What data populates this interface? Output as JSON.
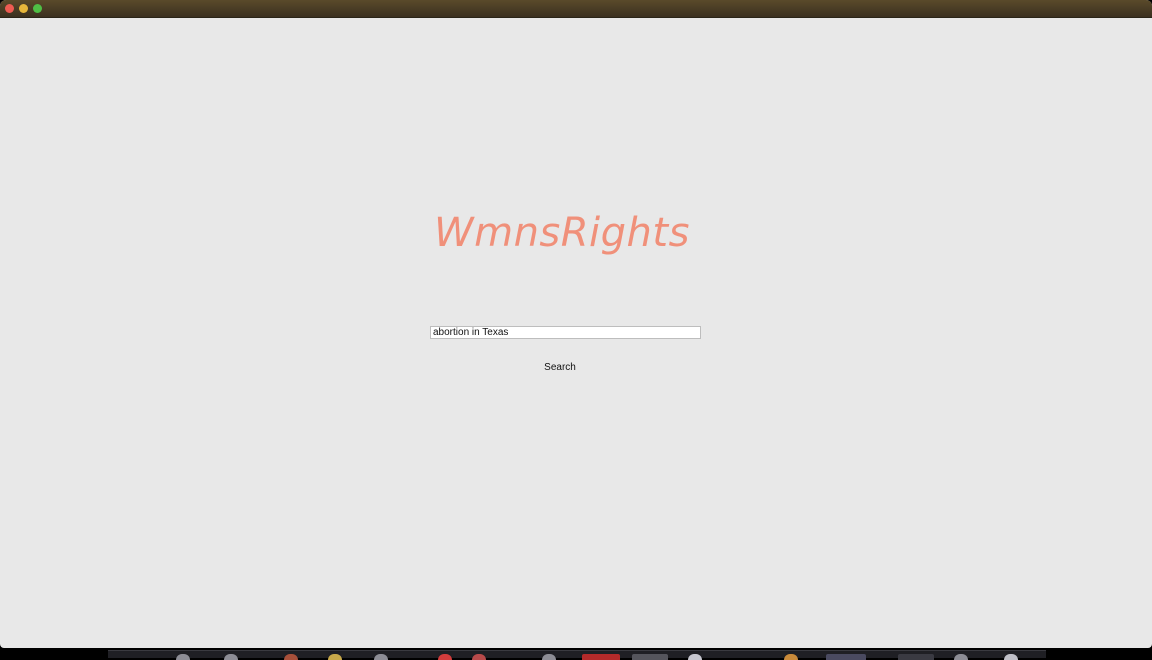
{
  "window": {
    "controls": [
      "close",
      "minimize",
      "maximize"
    ]
  },
  "app": {
    "title": "WmnsRights"
  },
  "search": {
    "value": "abortion in Texas",
    "button_label": "Search"
  },
  "colors": {
    "title": "#f0907a",
    "background": "#e8e8e8",
    "titlebar": "#4a3c24"
  },
  "dock": {
    "icons": [
      "app-icon",
      "app-icon",
      "app-icon",
      "app-icon",
      "app-icon",
      "app-icon",
      "app-icon",
      "app-icon",
      "app-icon",
      "app-icon",
      "app-icon",
      "app-icon",
      "app-icon",
      "app-icon",
      "app-icon",
      "app-icon",
      "app-icon"
    ]
  }
}
